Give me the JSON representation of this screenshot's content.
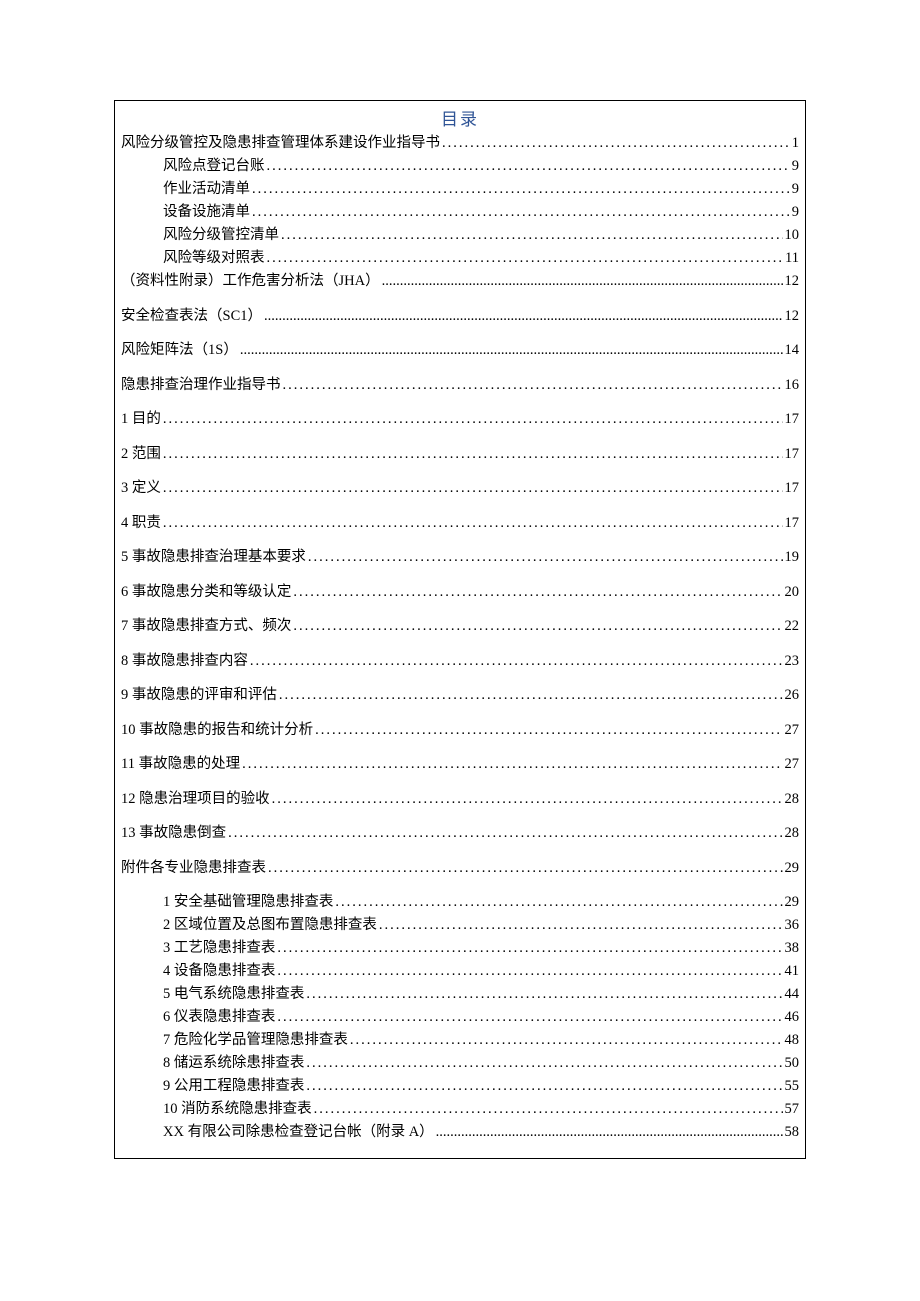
{
  "title": "目录",
  "section_a": [
    {
      "label": "风险分级管控及隐患排查管理体系建设作业指导书",
      "page": "1",
      "indent": 0
    },
    {
      "label": "风险点登记台账",
      "page": "9",
      "indent": 1
    },
    {
      "label": "作业活动清单",
      "page": "9",
      "indent": 1
    },
    {
      "label": "设备设施清单",
      "page": "9",
      "indent": 1
    },
    {
      "label": "风险分级管控清单",
      "page": "10",
      "indent": 1
    },
    {
      "label": "风险等级对照表",
      "page": "11",
      "indent": 1
    }
  ],
  "section_b": [
    {
      "label": "（资料性附录）工作危害分析法（JHA）",
      "page": "12",
      "tight": true
    },
    {
      "label": "安全检查表法（SC1）",
      "page": "12",
      "tight": true
    },
    {
      "label": "风险矩阵法（1S）",
      "page": "14",
      "tight": true
    },
    {
      "label": "隐患排查治理作业指导书",
      "page": "16"
    },
    {
      "label": "1 目的",
      "page": "17"
    },
    {
      "label": "2 范围",
      "page": "17"
    },
    {
      "label": "3 定义",
      "page": "17"
    },
    {
      "label": "4 职责",
      "page": "17"
    },
    {
      "label": "5 事故隐患排查治理基本要求",
      "page": "19"
    },
    {
      "label": "6 事故隐患分类和等级认定",
      "page": "20"
    },
    {
      "label": "7 事故隐患排查方式、频次",
      "page": "22"
    },
    {
      "label": "8 事故隐患排查内容",
      "page": "23"
    },
    {
      "label": "9 事故隐患的评审和评估",
      "page": "26"
    },
    {
      "label": "10 事故隐患的报告和统计分析",
      "page": "27"
    },
    {
      "label": "11 事故隐患的处理",
      "page": "27"
    },
    {
      "label": "12 隐患治理项目的验收",
      "page": "28"
    },
    {
      "label": "13 事故隐患倒查",
      "page": "28"
    },
    {
      "label": "附件各专业隐患排查表",
      "page": "29"
    }
  ],
  "section_c": [
    {
      "label": "1 安全基础管理隐患排查表",
      "page": "29"
    },
    {
      "label": "2 区域位置及总图布置隐患排查表",
      "page": "36"
    },
    {
      "label": "3 工艺隐患排查表",
      "page": "38"
    },
    {
      "label": "4 设备隐患排查表",
      "page": "41"
    },
    {
      "label": "5 电气系统隐患排查表",
      "page": "44"
    },
    {
      "label": "6 仪表隐患排查表",
      "page": "46"
    },
    {
      "label": "7 危险化学品管理隐患排查表",
      "page": "48"
    },
    {
      "label": "8 储运系统除患排查表",
      "page": "50"
    },
    {
      "label": "9 公用工程隐患排查表",
      "page": "55"
    },
    {
      "label": "10 消防系统隐患排查表",
      "page": "57"
    },
    {
      "label": "XX 有限公司除患检查登记台帐（附录 A）",
      "page": "58",
      "tight": true
    }
  ]
}
